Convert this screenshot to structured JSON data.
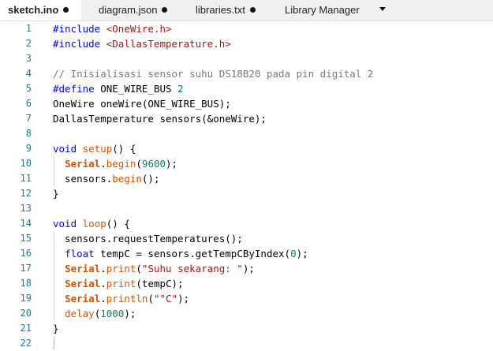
{
  "tabs": [
    {
      "label": "sketch.ino",
      "modified": true,
      "active": true
    },
    {
      "label": "diagram.json",
      "modified": true,
      "active": false
    },
    {
      "label": "libraries.txt",
      "modified": true,
      "active": false
    },
    {
      "label": "Library Manager",
      "modified": false,
      "active": false
    }
  ],
  "tabs_menu_icon": "chevron-down-icon",
  "editor": {
    "line_numbers": [
      "1",
      "2",
      "3",
      "4",
      "5",
      "6",
      "7",
      "8",
      "9",
      "10",
      "11",
      "12",
      "13",
      "14",
      "15",
      "16",
      "17",
      "18",
      "19",
      "20",
      "21",
      "22"
    ],
    "lines": [
      [
        [
          "kw",
          "#include"
        ],
        [
          "",
          " "
        ],
        [
          "str",
          "<OneWire.h>"
        ]
      ],
      [
        [
          "kw",
          "#include"
        ],
        [
          "",
          " "
        ],
        [
          "str",
          "<DallasTemperature.h>"
        ]
      ],
      [],
      [
        [
          "cmt",
          "// Inisialisasi sensor suhu DS18B20 pada pin digital 2"
        ]
      ],
      [
        [
          "kw",
          "#define"
        ],
        [
          "",
          " ONE_WIRE_BUS "
        ],
        [
          "num",
          "2"
        ]
      ],
      [
        [
          "",
          "OneWire oneWire(ONE_WIRE_BUS);"
        ]
      ],
      [
        [
          "",
          "DallasTemperature sensors(&oneWire);"
        ]
      ],
      [],
      [
        [
          "kw",
          "void"
        ],
        [
          "",
          " "
        ],
        [
          "fn",
          "setup"
        ],
        [
          "",
          "() {"
        ]
      ],
      [
        [
          "",
          "  "
        ],
        [
          "ser",
          "Serial"
        ],
        [
          "",
          "."
        ],
        [
          "fn",
          "begin"
        ],
        [
          "",
          "("
        ],
        [
          "num",
          "9600"
        ],
        [
          "",
          "); "
        ]
      ],
      [
        [
          "",
          "  sensors."
        ],
        [
          "fn",
          "begin"
        ],
        [
          "",
          "();"
        ]
      ],
      [
        [
          "",
          "}"
        ]
      ],
      [],
      [
        [
          "kw",
          "void"
        ],
        [
          "",
          " "
        ],
        [
          "fn",
          "loop"
        ],
        [
          "",
          "() {"
        ]
      ],
      [
        [
          "",
          "  sensors.requestTemperatures();"
        ]
      ],
      [
        [
          "",
          "  "
        ],
        [
          "kw",
          "float"
        ],
        [
          "",
          " tempC = sensors.getTempCByIndex("
        ],
        [
          "num",
          "0"
        ],
        [
          "",
          ");"
        ]
      ],
      [
        [
          "",
          "  "
        ],
        [
          "ser",
          "Serial"
        ],
        [
          "",
          "."
        ],
        [
          "fn",
          "print"
        ],
        [
          "",
          "("
        ],
        [
          "str",
          "\"Suhu sekarang: \""
        ],
        [
          "",
          ");"
        ]
      ],
      [
        [
          "",
          "  "
        ],
        [
          "ser",
          "Serial"
        ],
        [
          "",
          "."
        ],
        [
          "fn",
          "print"
        ],
        [
          "",
          "(tempC);"
        ]
      ],
      [
        [
          "",
          "  "
        ],
        [
          "ser",
          "Serial"
        ],
        [
          "",
          "."
        ],
        [
          "fn",
          "println"
        ],
        [
          "",
          "("
        ],
        [
          "str",
          "\"°C\""
        ],
        [
          "",
          ");"
        ]
      ],
      [
        [
          "",
          "  "
        ],
        [
          "fn",
          "delay"
        ],
        [
          "",
          "("
        ],
        [
          "num",
          "1000"
        ],
        [
          "",
          ");"
        ]
      ],
      [
        [
          "",
          "}"
        ]
      ],
      []
    ]
  },
  "colors": {
    "keyword": "#0000ff",
    "string": "#a31515",
    "comment": "#7a7a7a",
    "function": "#d35400",
    "number": "#098658",
    "line_number": "#237893"
  }
}
